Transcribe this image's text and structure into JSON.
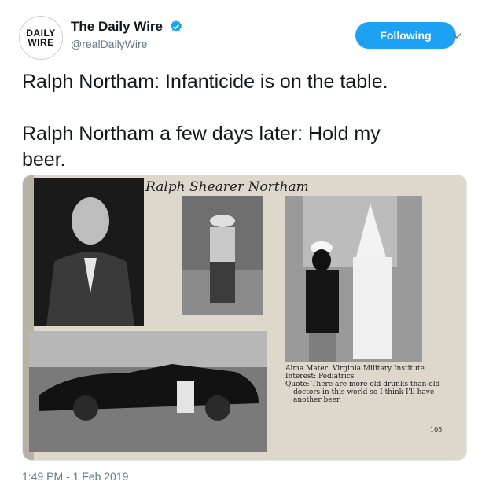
{
  "account": {
    "avatar_line1": "DAILY",
    "avatar_line2": "WIRE",
    "display_name": "The Daily Wire",
    "handle": "@realDailyWire",
    "verified": true
  },
  "follow_button": {
    "label": "Following"
  },
  "tweet": {
    "line1": "Ralph Northam: Infanticide is on the table.",
    "line2": "Ralph Northam a few days later: Hold my",
    "line3": "beer."
  },
  "media": {
    "page_title": "Ralph Shearer Northam",
    "caption_line1": "Alma Mater: Virginia Military Institute",
    "caption_line2": "Interest: Pediatrics",
    "caption_line3": "Quote: There are more old drunks than old",
    "caption_line4": "doctors in this world so I think I'll have",
    "caption_line5": "another beer.",
    "page_number": "105"
  },
  "timestamp": "1:49 PM - 1 Feb 2019",
  "colors": {
    "accent": "#1da1f2",
    "text": "#14171a",
    "muted": "#657786"
  },
  "icons": {
    "verified": "verified-badge-icon",
    "caret": "chevron-down-icon"
  }
}
